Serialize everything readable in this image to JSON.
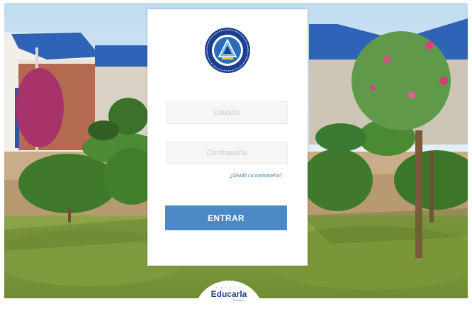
{
  "login": {
    "username_placeholder": "Usuario",
    "password_placeholder": "Contraseña",
    "forgot_password_link": "¿Olvidó su contraseña?",
    "submit_label": "ENTRAR"
  },
  "brand": {
    "name": "Educarla",
    "tagline": "Pro-Ana"
  },
  "colors": {
    "primary_button": "#4a88c6",
    "link": "#3f79b5",
    "card_background": "#ffffff",
    "seal_ring": "#1e3f8f",
    "brand_text": "#2a3f8a"
  },
  "icons": {
    "seal": "institution-seal-icon"
  }
}
